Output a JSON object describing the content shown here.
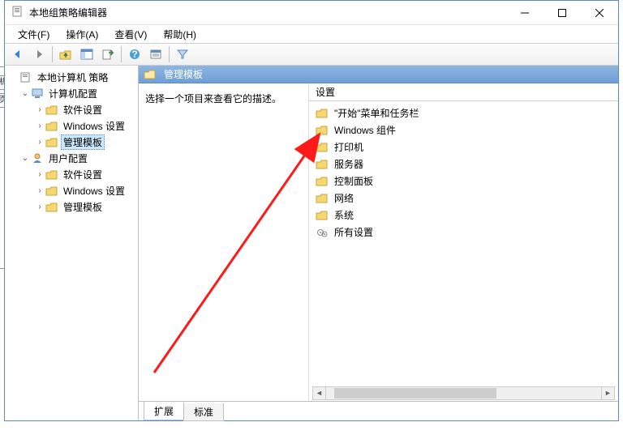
{
  "window": {
    "title": "本地组策略编辑器"
  },
  "menu": {
    "file": "文件(F)",
    "action": "操作(A)",
    "view": "查看(V)",
    "help": "帮助(H)"
  },
  "tree": {
    "root": "本地计算机 策略",
    "computer": "计算机配置",
    "c_soft": "软件设置",
    "c_win": "Windows 设置",
    "c_admin": "管理模板",
    "user": "用户配置",
    "u_soft": "软件设置",
    "u_win": "Windows 设置",
    "u_admin": "管理模板"
  },
  "right": {
    "header": "管理模板",
    "desc": "选择一个项目来查看它的描述。",
    "col_setting": "设置",
    "items": [
      "\"开始\"菜单和任务栏",
      "Windows 组件",
      "打印机",
      "服务器",
      "控制面板",
      "网络",
      "系统",
      "所有设置"
    ],
    "tab_ext": "扩展",
    "tab_std": "标准"
  },
  "leftedge": {
    "t1": "机",
    "t2": "页"
  }
}
